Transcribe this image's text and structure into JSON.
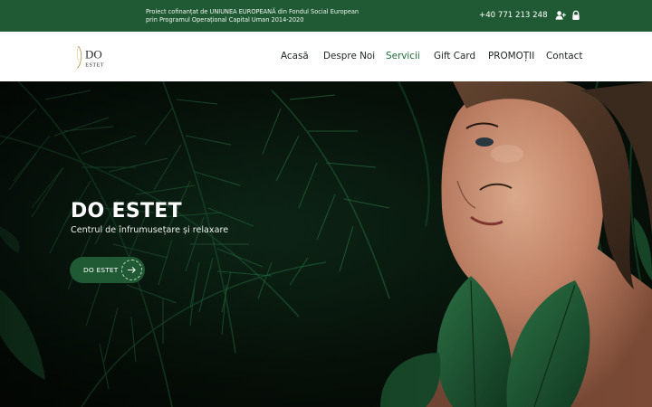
{
  "topbar": {
    "notice_line1": "Proiect cofinanțat de UNIUNEA EUROPEANĂ din Fondul Social European",
    "notice_line2": "prin Programul Operațional Capital Uman 2014-2020",
    "phone": "+40 771 213 248",
    "icons": [
      "add-user-icon",
      "lock-icon"
    ]
  },
  "navbar": {
    "logo_text_top": "DO",
    "logo_text_bottom": "ESTET",
    "items": [
      {
        "label": "Acasă",
        "active": false
      },
      {
        "label": "Despre Noi",
        "active": false
      },
      {
        "label": "Servicii",
        "active": true
      },
      {
        "label": "Gift Card",
        "active": false
      },
      {
        "label": "PROMOȚII",
        "active": false
      },
      {
        "label": "Contact",
        "active": false
      }
    ]
  },
  "hero": {
    "title": "DO ESTET",
    "subtitle": "Centrul de înfrumusețare și relaxare",
    "button_label": "DO ESTET",
    "button_icon": "arrow-right-icon"
  },
  "colors": {
    "brand_green": "#1f5a34",
    "active_nav": "#1f6b3b",
    "nav_text": "#1f2421",
    "logo_gold": "#b89a5a"
  }
}
